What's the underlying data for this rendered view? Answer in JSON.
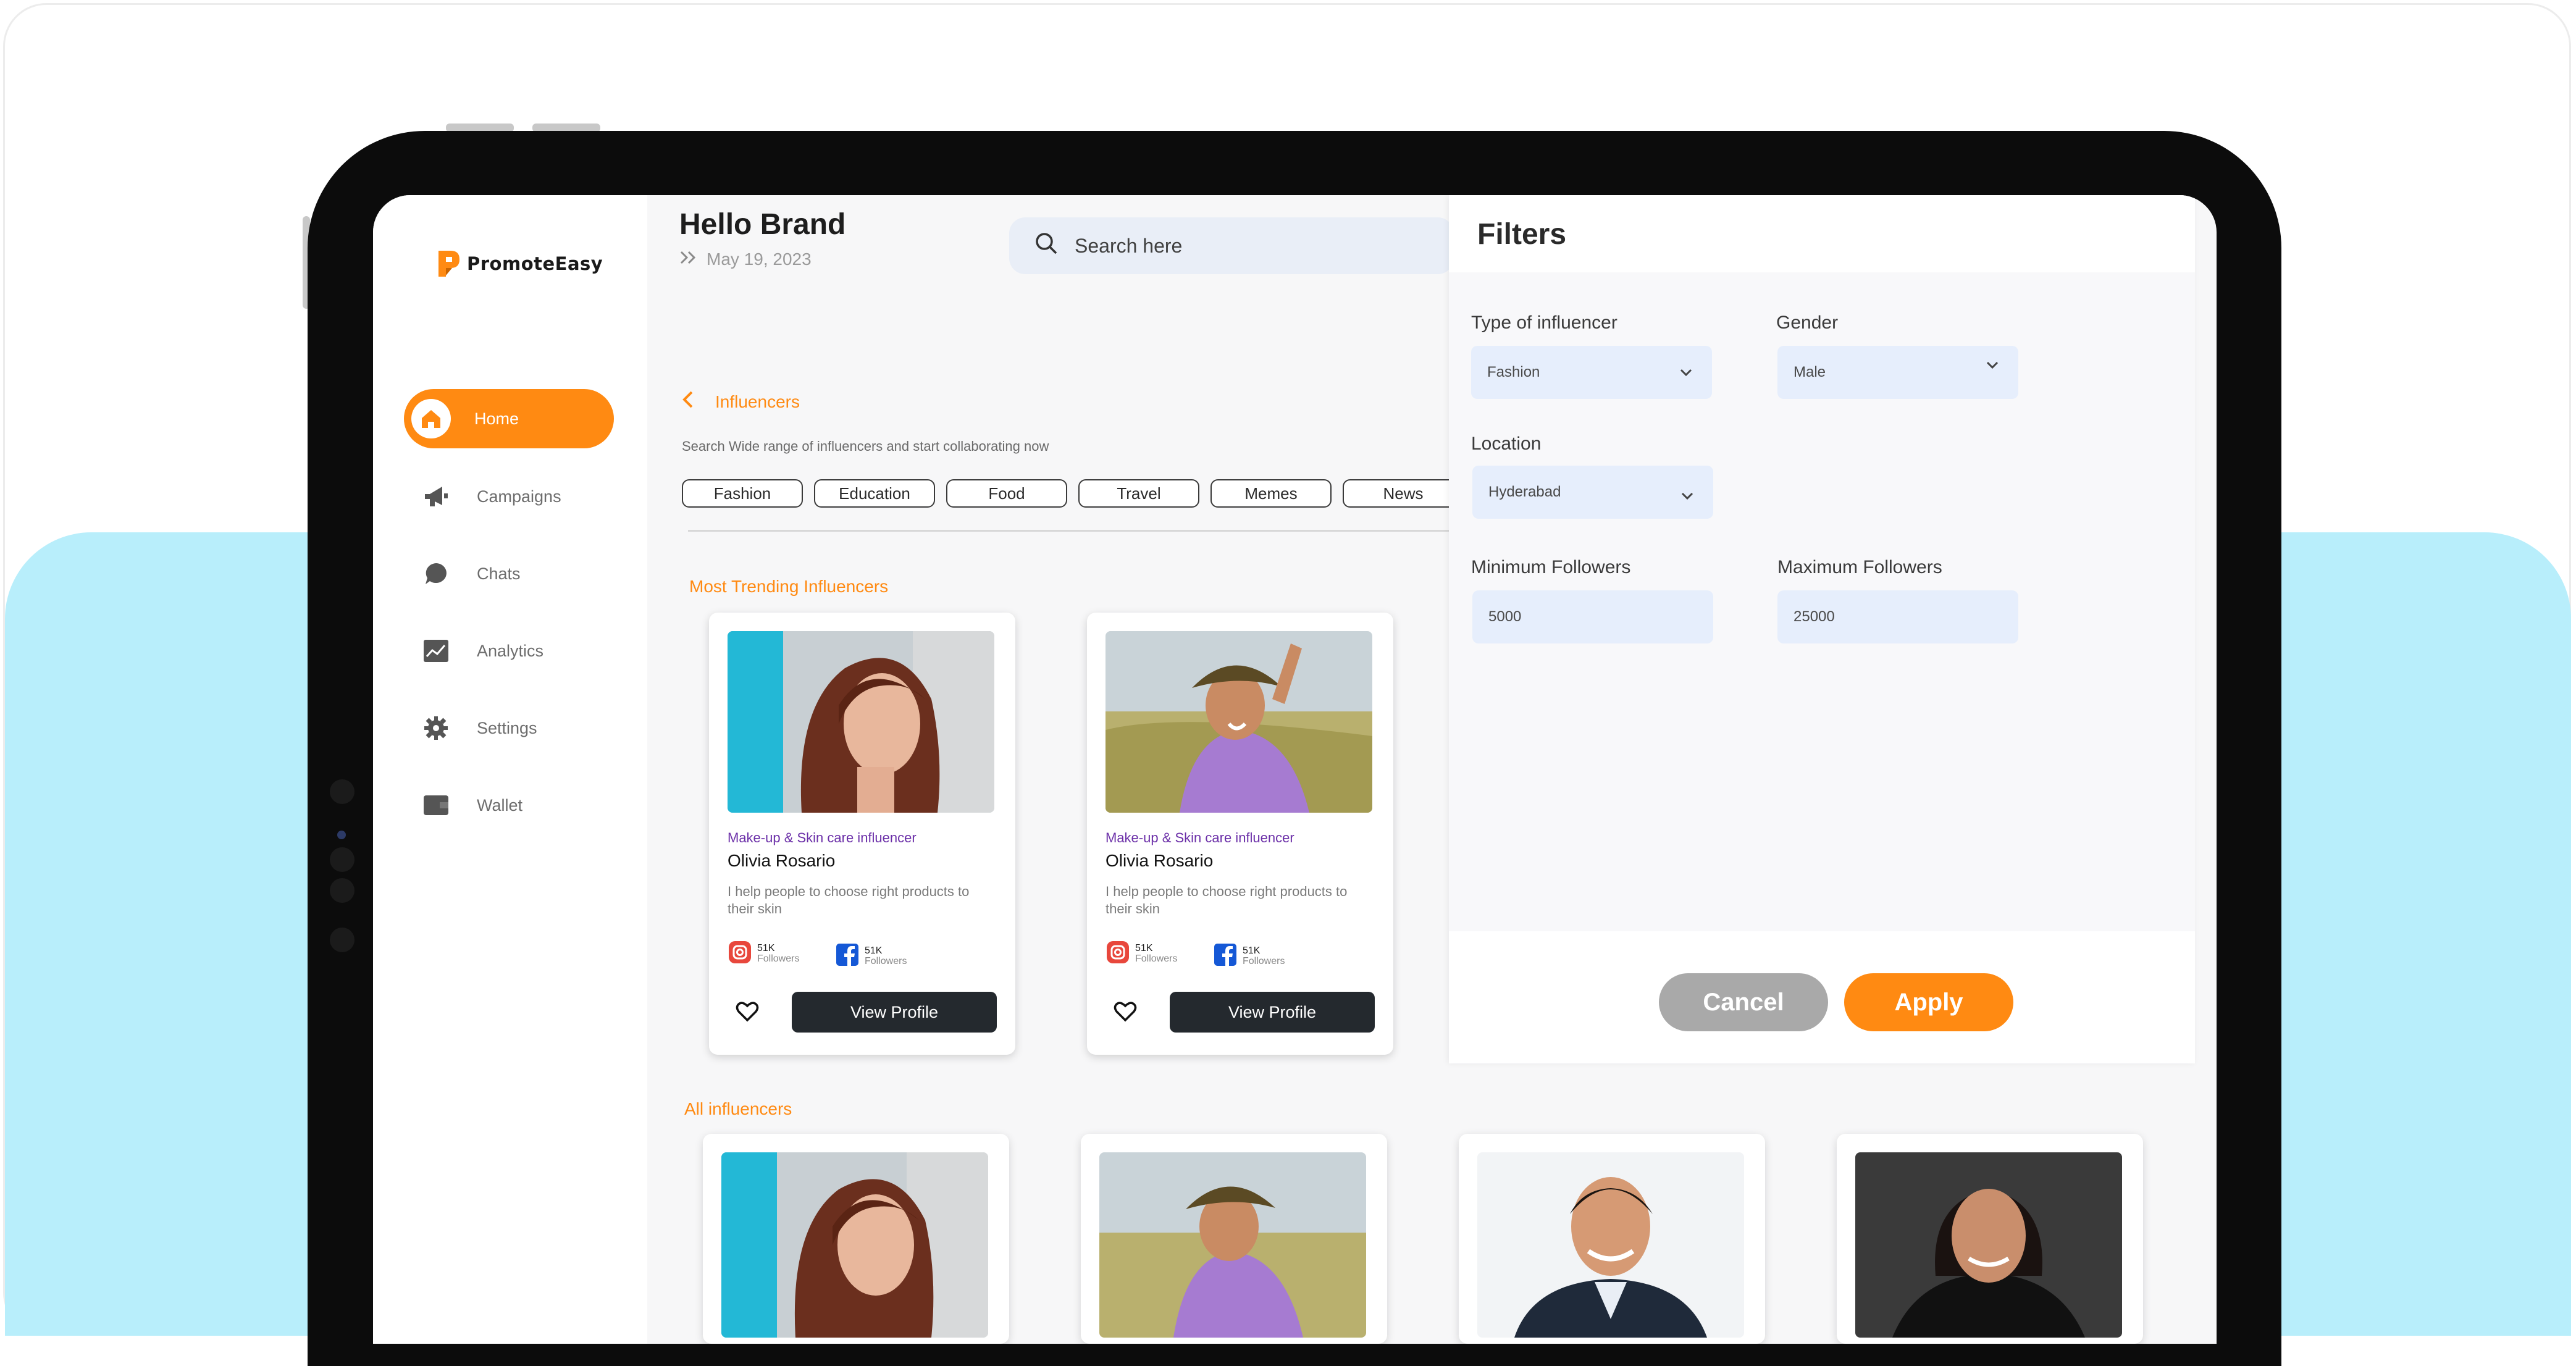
{
  "app": {
    "logo_text": "PromoteEasy"
  },
  "header": {
    "greeting": "Hello Brand",
    "date": "May 19, 2023",
    "search_placeholder": "Search here"
  },
  "sidebar": {
    "items": [
      {
        "label": "Home",
        "icon": "home-icon",
        "active": true
      },
      {
        "label": "Campaigns",
        "icon": "megaphone-icon"
      },
      {
        "label": "Chats",
        "icon": "chat-bubble-icon"
      },
      {
        "label": "Analytics",
        "icon": "analytics-icon"
      },
      {
        "label": "Settings",
        "icon": "gear-icon"
      },
      {
        "label": "Wallet",
        "icon": "wallet-icon"
      }
    ]
  },
  "main": {
    "breadcrumb": "Influencers",
    "subtitle": "Search Wide range of influencers and start collaborating now",
    "categories": [
      "Fashion",
      "Education",
      "Food",
      "Travel",
      "Memes",
      "News"
    ],
    "trending_title": "Most Trending Influencers",
    "all_title": "All influencers",
    "trending": [
      {
        "category": "Make-up & Skin care influencer",
        "name": "Olivia Rosario",
        "description": "I help people to choose right products to their skin",
        "instagram_count": "51K",
        "instagram_label": "Followers",
        "facebook_count": "51K",
        "facebook_label": "Followers",
        "button": "View Profile"
      },
      {
        "category": "Make-up & Skin care influencer",
        "name": "Olivia Rosario",
        "description": "I help people to choose right products to their skin",
        "instagram_count": "51K",
        "instagram_label": "Followers",
        "facebook_count": "51K",
        "facebook_label": "Followers",
        "button": "View Profile"
      }
    ]
  },
  "filters": {
    "title": "Filters",
    "type_label": "Type of influencer",
    "type_value": "Fashion",
    "gender_label": "Gender",
    "gender_value": "Male",
    "location_label": "Location",
    "location_value": "Hyderabad",
    "min_label": "Minimum Followers",
    "min_value": "5000",
    "max_label": "Maximum Followers",
    "max_value": "25000",
    "cancel": "Cancel",
    "apply": "Apply"
  },
  "colors": {
    "accent": "#ff8a12",
    "background_band": "#b8eefb",
    "dark_button": "#24292e",
    "cancel_button": "#a9a9a9",
    "category_text": "#6b2fa8"
  }
}
